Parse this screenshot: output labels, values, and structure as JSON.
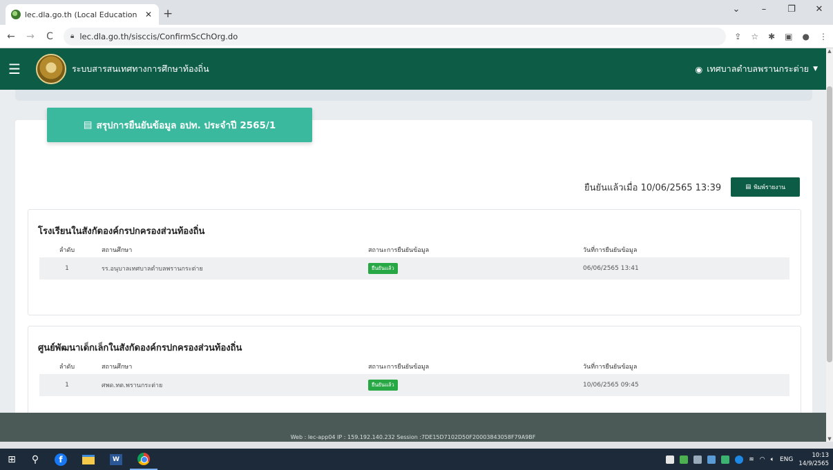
{
  "browser": {
    "tab_title": "lec.dla.go.th (Local Education Ce",
    "tab_close": "✕",
    "new_tab": "+",
    "url": "lec.dla.go.th/sisccis/ConfirmScChOrg.do",
    "win_minimize": "–",
    "win_maximize": "❐",
    "win_close": "✕",
    "win_dropdown": "⌄"
  },
  "header": {
    "title": "ระบบสารสนเทศทางการศึกษาท้องถิ่น",
    "user": "เทศบาลตำบลพรานกระต่าย"
  },
  "card": {
    "title": "สรุปการยืนยันข้อมูล อปท. ประจำปี 2565/1",
    "confirmed_text": "ยืนยันแล้วเมื่อ 10/06/2565 13:39",
    "print_button": "พิมพ์รายงาน"
  },
  "sections": [
    {
      "heading": "โรงเรียนในสังกัดองค์กรปกครองส่วนท้องถิ่น",
      "columns": [
        "ลำดับ",
        "สถานศึกษา",
        "สถานะการยืนยันข้อมูล",
        "วันที่การยืนยันข้อมูล"
      ],
      "rows": [
        {
          "no": "1",
          "name": "รร.อนุบาลเทศบาลตำบลพรานกระต่าย",
          "status": "ยืนยันแล้ว",
          "date": "06/06/2565 13:41"
        }
      ]
    },
    {
      "heading": "ศูนย์พัฒนาเด็กเล็กในสังกัดองค์กรปกครองส่วนท้องถิ่น",
      "columns": [
        "ลำดับ",
        "สถานศึกษา",
        "สถานะการยืนยันข้อมูล",
        "วันที่การยืนยันข้อมูล"
      ],
      "rows": [
        {
          "no": "1",
          "name": "ศพด.ทต.พรานกระต่าย",
          "status": "ยืนยันแล้ว",
          "date": "10/06/2565 09:45"
        }
      ]
    }
  ],
  "footer": {
    "text": "Web : lec-app04  IP : 159.192.140.232   Session :7DE15D7102D50F20003843058F79A9BF"
  },
  "taskbar": {
    "lang": "ENG",
    "time": "10:13",
    "date": "14/9/2565"
  },
  "colors": {
    "header_green": "#0d5c45",
    "title_teal": "#3ab99e",
    "badge_green": "#28a745"
  }
}
